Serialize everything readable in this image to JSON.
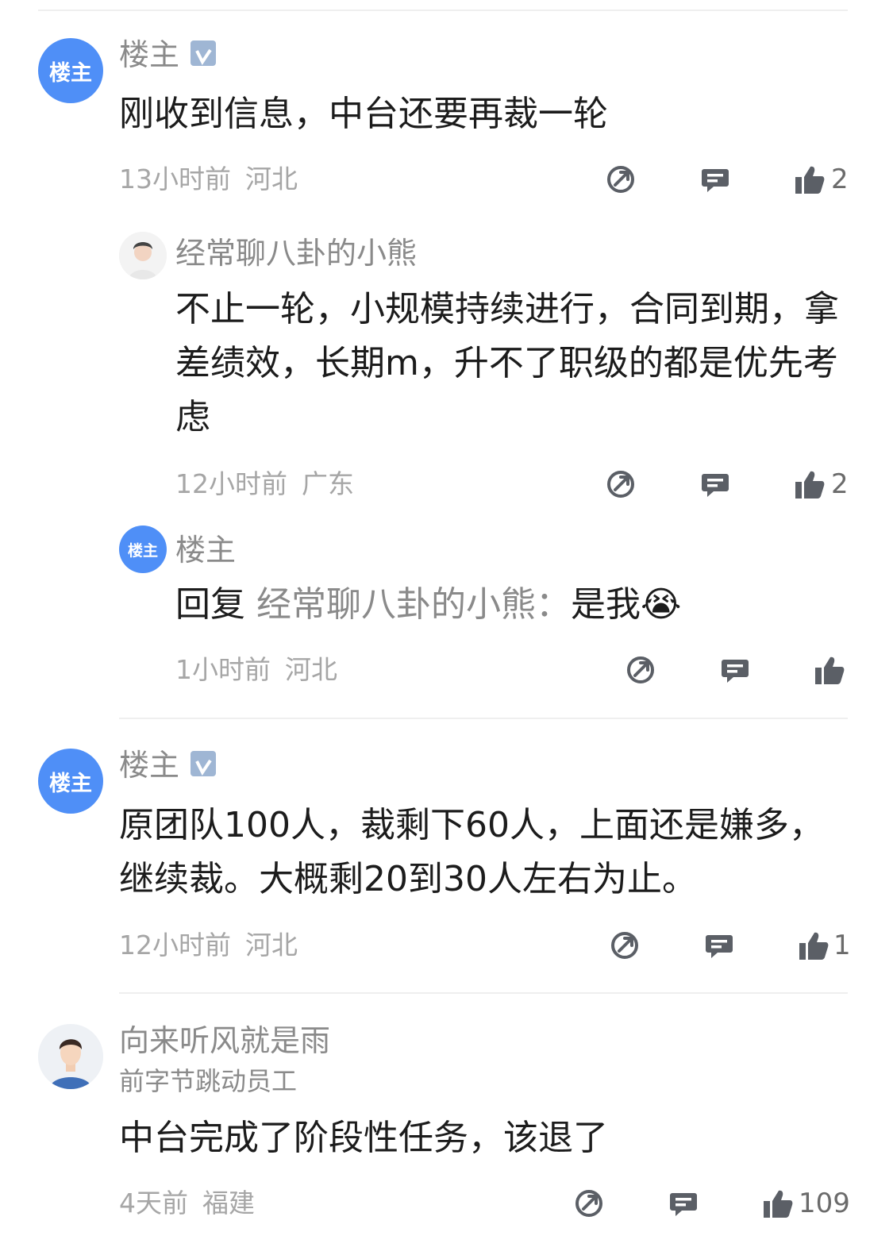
{
  "colors": {
    "accent": "#4f8ff7",
    "icon": "#5b5f66",
    "meta": "#a6a6a6"
  },
  "comments": [
    {
      "avatar_label": "楼主",
      "name": "楼主",
      "content": "刚收到信息，中台还要再裁一轮",
      "time": "13小时前",
      "location": "河北",
      "likes": "2"
    },
    {
      "name": "经常聊八卦的小熊",
      "content": "不止一轮，小规模持续进行，合同到期，拿差绩效，长期m，升不了职级的都是优先考虑",
      "time": "12小时前",
      "location": "广东",
      "likes": "2"
    },
    {
      "avatar_label": "楼主",
      "name": "楼主",
      "reply_prefix": "回复",
      "reply_to": "经常聊八卦的小熊：",
      "content": "是我😭",
      "time": "1小时前",
      "location": "河北",
      "likes": ""
    },
    {
      "avatar_label": "楼主",
      "name": "楼主",
      "content": "原团队100人，裁剩下60人，上面还是嫌多，继续裁。大概剩20到30人左右为止。",
      "time": "12小时前",
      "location": "河北",
      "likes": "1"
    },
    {
      "name": "向来听风就是雨",
      "subtitle": "前字节跳动员工",
      "content": "中台完成了阶段性任务，该退了",
      "time": "4天前",
      "location": "福建",
      "likes": "109"
    }
  ]
}
